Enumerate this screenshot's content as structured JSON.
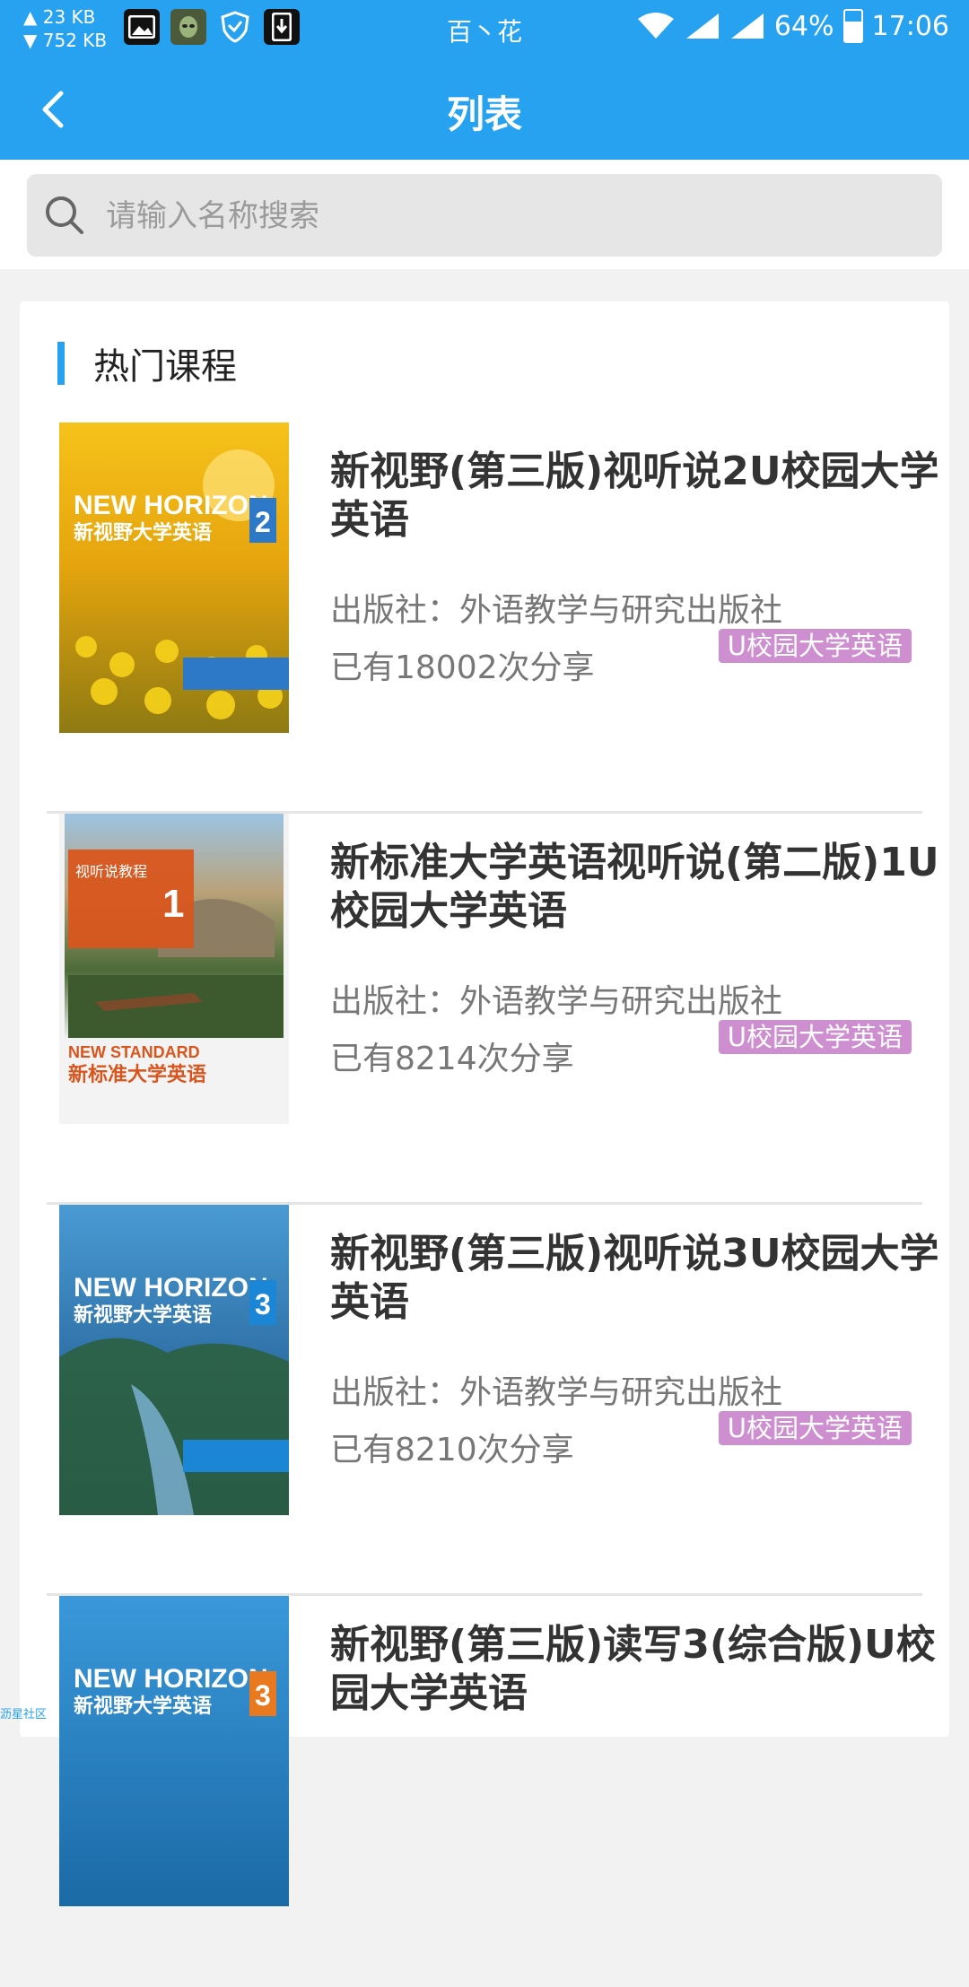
{
  "status_bar": {
    "net_up": "23 KB",
    "net_down": "752 KB",
    "carrier": "百丶花",
    "battery": "64%",
    "time": "17:06",
    "icons": [
      "image-icon",
      "alien-app-icon",
      "shield-icon",
      "download-icon",
      "wifi-icon",
      "signal-icon",
      "signal-icon",
      "battery-icon"
    ]
  },
  "nav": {
    "title": "列表",
    "back_icon": "chevron-left-icon"
  },
  "search": {
    "placeholder": "请输入名称搜索",
    "value": ""
  },
  "section": {
    "title": "热门课程"
  },
  "courses": [
    {
      "title": "新视野(第三版)视听说2U校园大学英语",
      "publisher": "出版社：外语教学与研究出版社",
      "shares": "已有18002次分享",
      "tag": "U校园大学英语",
      "cover_colors": [
        "#F4B514",
        "#C98E0D"
      ],
      "cover_number": "2",
      "cover_title": "新视野大学英语",
      "cover_brand": "NEW HORIZON"
    },
    {
      "title": "新标准大学英语视听说(第二版)1U校园大学英语",
      "publisher": "出版社：外语教学与研究出版社",
      "shares": "已有8214次分享",
      "tag": "U校园大学英语",
      "cover_colors": [
        "#6FA3C8",
        "#4F6E3A"
      ],
      "cover_number": "1",
      "cover_title": "新标准大学英语",
      "cover_brand": "NEW STANDARD"
    },
    {
      "title": "新视野(第三版)视听说3U校园大学英语",
      "publisher": "出版社：外语教学与研究出版社",
      "shares": "已有8210次分享",
      "tag": "U校园大学英语",
      "cover_colors": [
        "#3F8FCB",
        "#1F5E8C"
      ],
      "cover_number": "3",
      "cover_title": "新视野大学英语",
      "cover_brand": "NEW HORIZON"
    },
    {
      "title": "新视野(第三版)读写3(综合版)U校园大学英语",
      "publisher": "",
      "shares": "",
      "tag": "",
      "cover_colors": [
        "#2F8FD0",
        "#1A6AA5"
      ],
      "cover_number": "3",
      "cover_title": "新视野大学英语",
      "cover_brand": "NEW HORIZON"
    }
  ],
  "watermark": "沥星社区"
}
